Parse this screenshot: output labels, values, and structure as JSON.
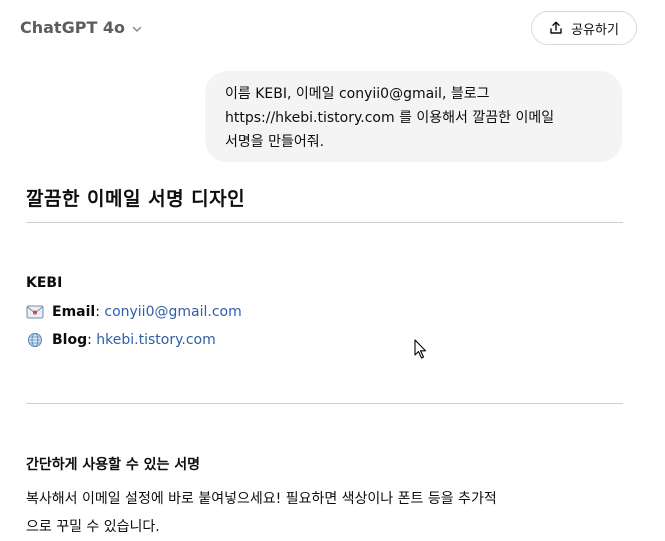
{
  "header": {
    "model_name": "ChatGPT 4o",
    "share_label": "공유하기"
  },
  "user_message": {
    "lines": [
      "이름 KEBI, 이메일 conyii0@gmail, 블로그",
      "https://hkebi.tistory.com 를 이용해서 깔끔한 이메일",
      "서명을 만들어줘."
    ]
  },
  "response": {
    "title": "깔끔한 이메일 서명 디자인",
    "signature": {
      "name": "KEBI",
      "email_label": "Email",
      "email_value": "conyii0@gmail.com",
      "blog_label": "Blog",
      "blog_value": "hkebi.tistory.com",
      "email_icon": "envelope-icon",
      "blog_icon": "globe-icon"
    },
    "subheading": "간단하게 사용할 수 있는 서명",
    "paragraph_lines": [
      "복사해서 이메일 설정에 바로 붙여넣으세요! 필요하면 색상이나 폰트 등을 추가적",
      "으로 꾸밀 수 있습니다."
    ]
  },
  "colors": {
    "link": "#2f5fa8",
    "bubble": "#f4f4f4",
    "divider": "#cfcfcf"
  }
}
